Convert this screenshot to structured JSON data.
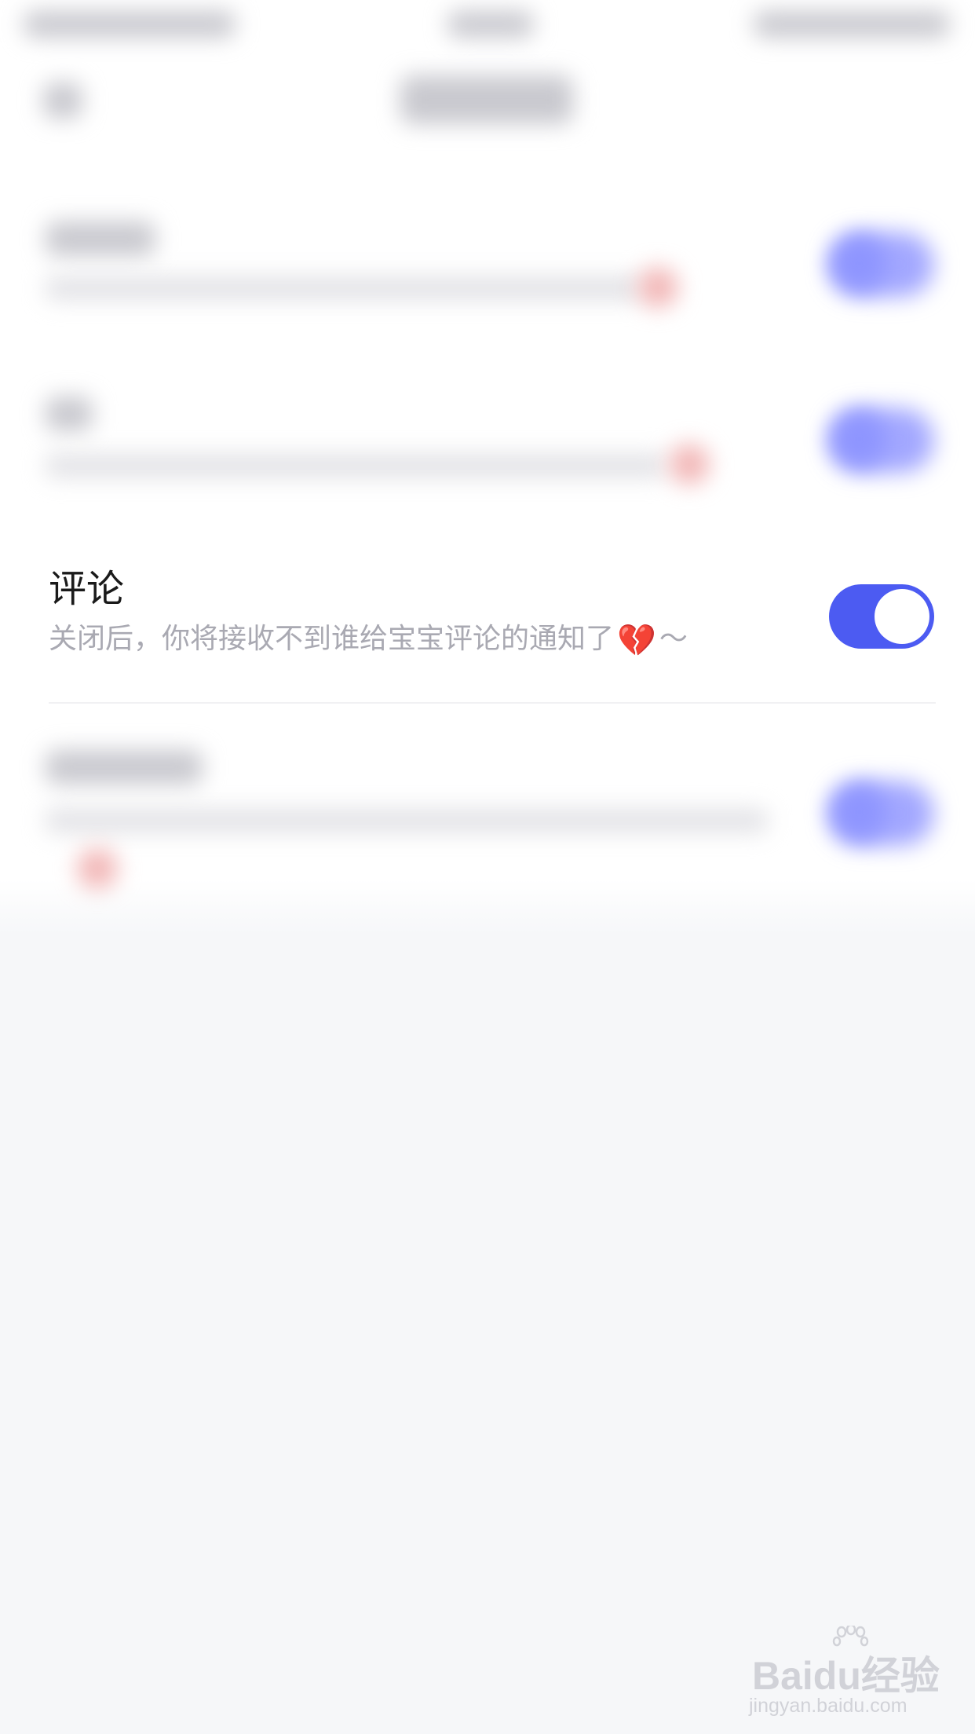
{
  "settings": {
    "comment": {
      "title": "评论",
      "description": "关闭后，你将接收不到谁给宝宝评论的通知了",
      "emoji": "💔",
      "suffix": "～",
      "toggle_on": true
    }
  },
  "colors": {
    "accent": "#4c5bf2",
    "description": "#a9a9b2",
    "title": "#1a1a1a",
    "background": "#f6f7f9"
  },
  "icons": {
    "broken_heart": "broken-heart-icon"
  },
  "watermark": {
    "brand": "Baidu经验",
    "url": "jingyan.baidu.com"
  }
}
